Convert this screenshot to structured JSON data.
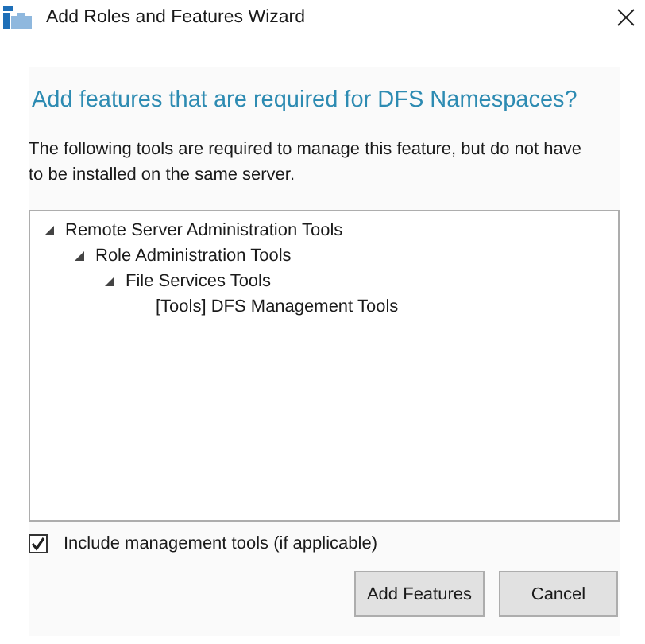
{
  "window": {
    "title": "Add Roles and Features Wizard"
  },
  "heading": "Add features that are required for DFS Namespaces?",
  "description": "The following tools are required to manage this feature, but do not have to be installed on the same server.",
  "tree": [
    {
      "label": "Remote Server Administration Tools",
      "expanded": true,
      "children": [
        {
          "label": "Role Administration Tools",
          "expanded": true,
          "children": [
            {
              "label": "File Services Tools",
              "expanded": true,
              "children": [
                {
                  "label": "[Tools] DFS Management Tools"
                }
              ]
            }
          ]
        }
      ]
    }
  ],
  "include_tools": {
    "label": "Include management tools (if applicable)",
    "checked": true
  },
  "buttons": [
    "Add Features",
    "Cancel"
  ]
}
